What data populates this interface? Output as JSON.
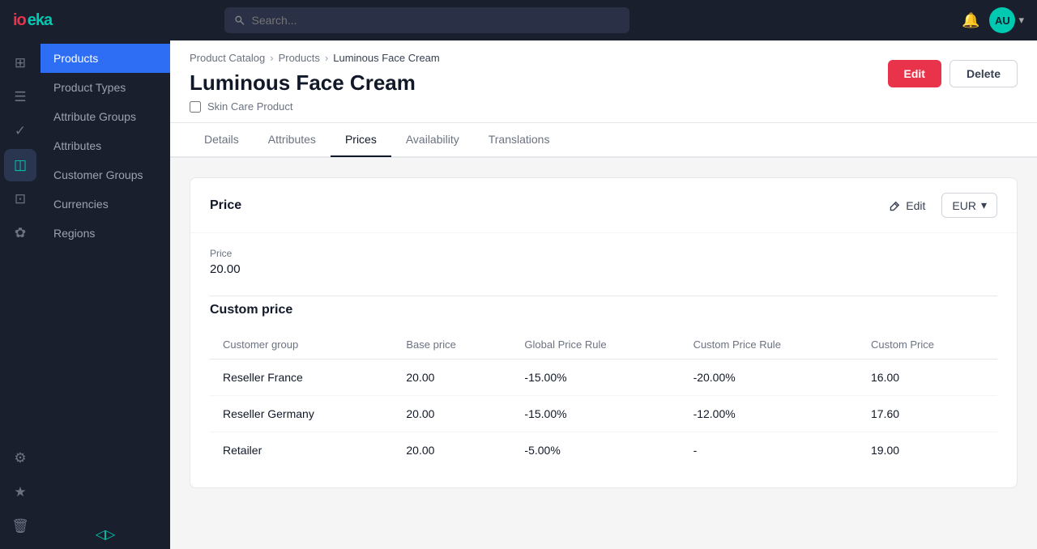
{
  "topnav": {
    "logo_io": "io",
    "logo_eka": "eka",
    "search_placeholder": "Search...",
    "avatar_initials": "AU",
    "avatar_chevron": "▾"
  },
  "breadcrumb": {
    "catalog": "Product Catalog",
    "products": "Products",
    "current": "Luminous Face Cream"
  },
  "product": {
    "title": "Luminous Face Cream",
    "subtitle": "Skin Care Product"
  },
  "header_actions": {
    "edit_label": "Edit",
    "delete_label": "Delete"
  },
  "tabs": [
    {
      "id": "details",
      "label": "Details"
    },
    {
      "id": "attributes",
      "label": "Attributes"
    },
    {
      "id": "prices",
      "label": "Prices"
    },
    {
      "id": "availability",
      "label": "Availability"
    },
    {
      "id": "translations",
      "label": "Translations"
    }
  ],
  "price_card": {
    "title": "Price",
    "edit_label": "Edit",
    "currency": "EUR",
    "price_label": "Price",
    "price_value": "20.00"
  },
  "custom_price": {
    "title": "Custom price",
    "columns": {
      "customer_group": "Customer group",
      "base_price": "Base price",
      "global_price_rule": "Global Price Rule",
      "custom_price_rule": "Custom Price Rule",
      "custom_price": "Custom Price"
    },
    "rows": [
      {
        "customer_group": "Reseller France",
        "base_price": "20.00",
        "global_price_rule": "-15.00%",
        "global_price_rule_colored": true,
        "custom_price_rule": "-20.00%",
        "custom_price": "16.00"
      },
      {
        "customer_group": "Reseller Germany",
        "base_price": "20.00",
        "global_price_rule": "-15.00%",
        "global_price_rule_colored": true,
        "custom_price_rule": "-12.00%",
        "custom_price": "17.60"
      },
      {
        "customer_group": "Retailer",
        "base_price": "20.00",
        "global_price_rule": "-5.00%",
        "global_price_rule_colored": false,
        "custom_price_rule": "-",
        "custom_price": "19.00"
      }
    ]
  },
  "sidebar": {
    "items": [
      {
        "id": "products",
        "label": "Products",
        "active": true
      },
      {
        "id": "product-types",
        "label": "Product Types",
        "active": false
      },
      {
        "id": "attribute-groups",
        "label": "Attribute Groups",
        "active": false
      },
      {
        "id": "attributes",
        "label": "Attributes",
        "active": false
      },
      {
        "id": "customer-groups",
        "label": "Customer Groups",
        "active": false
      },
      {
        "id": "currencies",
        "label": "Currencies",
        "active": false
      },
      {
        "id": "regions",
        "label": "Regions",
        "active": false
      }
    ],
    "icons": [
      {
        "id": "dashboard",
        "symbol": "⊞",
        "active": false
      },
      {
        "id": "orders",
        "symbol": "≡",
        "active": false
      },
      {
        "id": "tasks",
        "symbol": "✓",
        "active": false
      },
      {
        "id": "catalog",
        "symbol": "◫",
        "active": true
      },
      {
        "id": "cart",
        "symbol": "🛒",
        "active": false
      },
      {
        "id": "users",
        "symbol": "❋",
        "active": false
      }
    ],
    "bottom_icons": [
      {
        "id": "settings",
        "symbol": "⚙",
        "active": false
      },
      {
        "id": "star",
        "symbol": "★",
        "active": false
      },
      {
        "id": "trash",
        "symbol": "🗑",
        "active": false
      }
    ],
    "footer_symbol": "◁▷"
  }
}
